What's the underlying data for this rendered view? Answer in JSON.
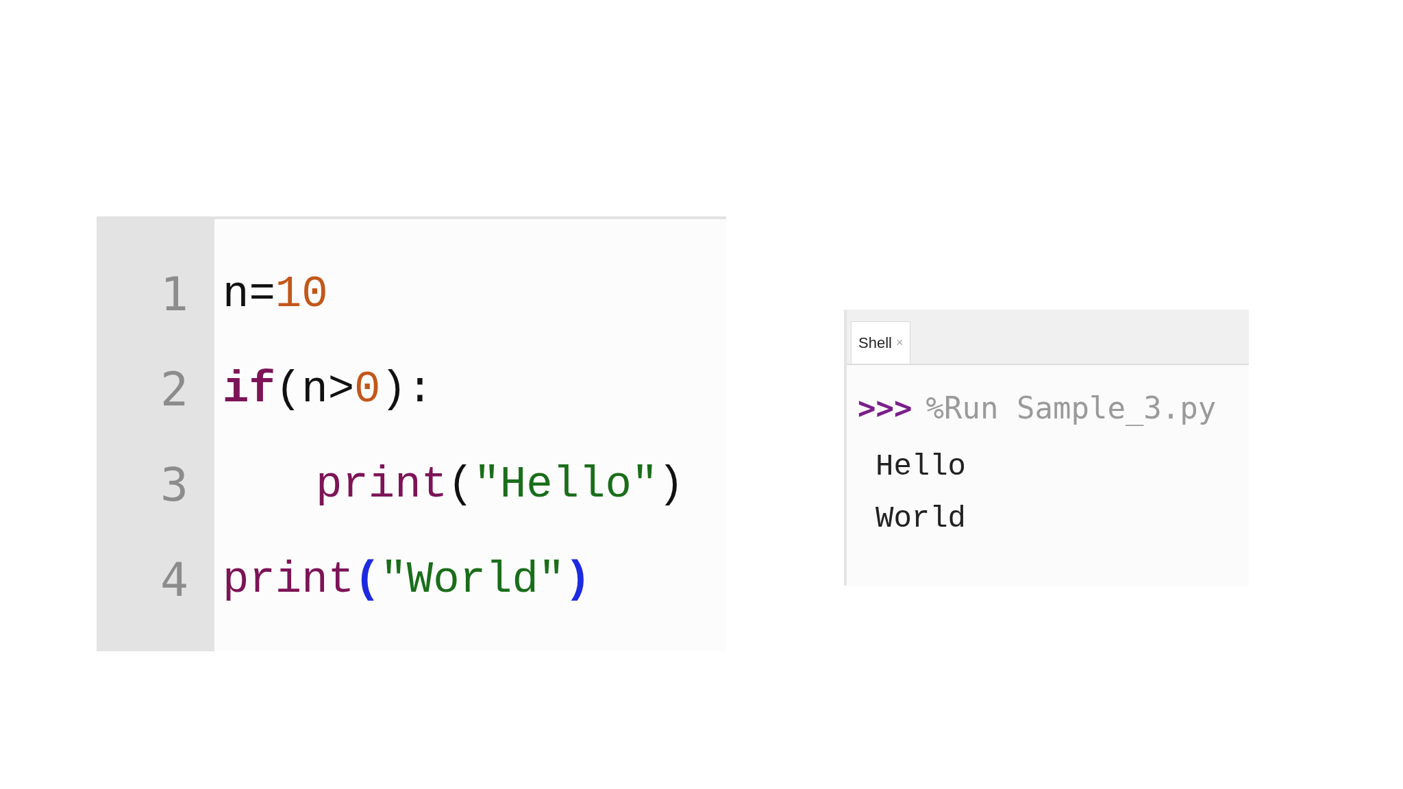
{
  "editor": {
    "lines": [
      {
        "number": "1",
        "tokens": [
          {
            "text": "n=",
            "kind": "plain"
          },
          {
            "text": "10",
            "kind": "number"
          }
        ]
      },
      {
        "number": "2",
        "tokens": [
          {
            "text": "if",
            "kind": "keyword"
          },
          {
            "text": "(n>",
            "kind": "plain"
          },
          {
            "text": "0",
            "kind": "number"
          },
          {
            "text": "):",
            "kind": "plain"
          }
        ],
        "children": [
          {
            "number": "3",
            "tokens": [
              {
                "text": "print",
                "kind": "builtin"
              },
              {
                "text": "(",
                "kind": "plain"
              },
              {
                "text": "\"Hello\"",
                "kind": "string"
              },
              {
                "text": ")",
                "kind": "plain"
              }
            ]
          }
        ]
      },
      {
        "number": "4",
        "tokens": [
          {
            "text": "print",
            "kind": "builtin"
          },
          {
            "text": "(",
            "kind": "bracket-match"
          },
          {
            "text": "\"World\"",
            "kind": "string"
          },
          {
            "text": ")",
            "kind": "bracket-match"
          }
        ]
      }
    ]
  },
  "shell": {
    "tab": {
      "label": "Shell",
      "close": "×",
      "selected": true
    },
    "prompt": ">>>",
    "command": "%Run Sample_3.py",
    "output": [
      "Hello",
      "World"
    ]
  }
}
